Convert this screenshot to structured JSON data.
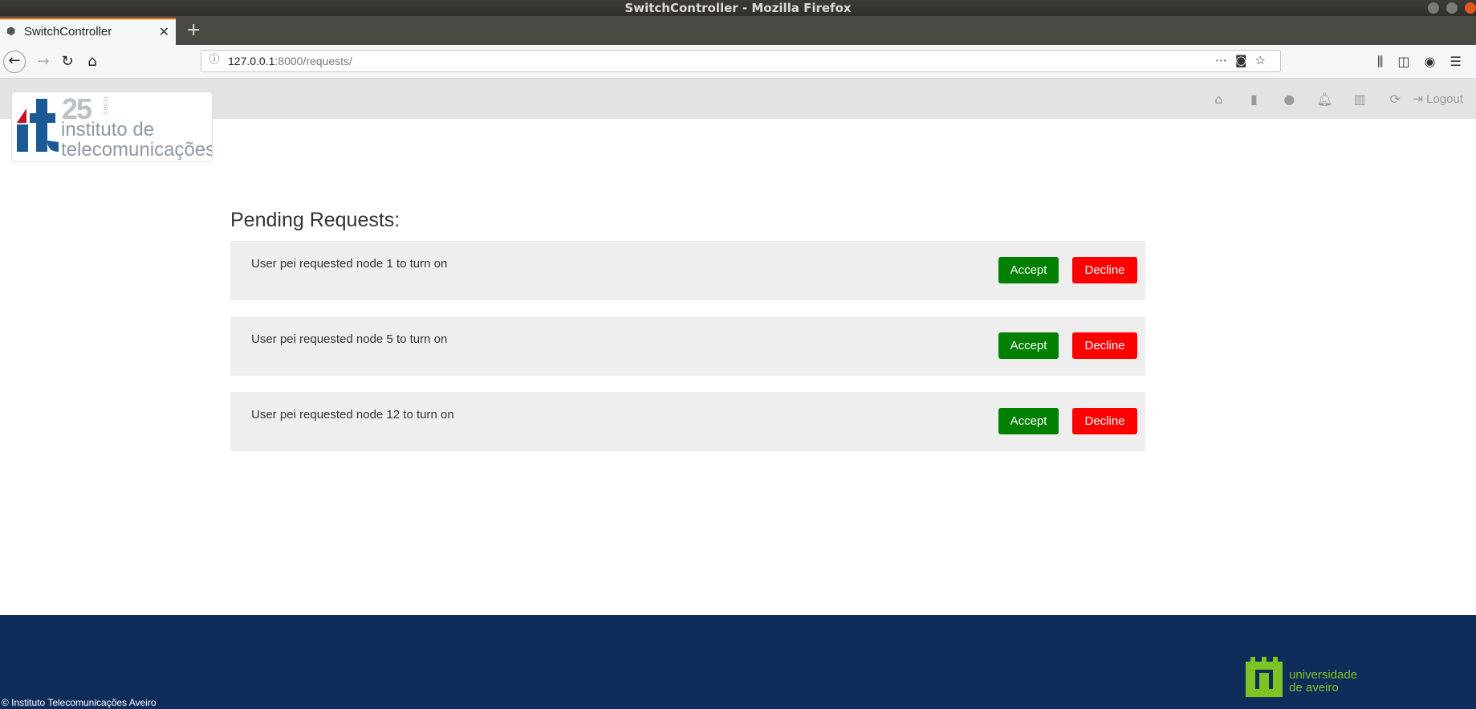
{
  "window": {
    "title": "SwitchController - Mozilla Firefox"
  },
  "browser": {
    "tab_title": "SwitchController",
    "url_host": "127.0.0.1",
    "url_rest": ":8000/requests/",
    "new_tab_symbol": "+"
  },
  "header": {
    "logo": {
      "years_number": "25",
      "years_label": "YEARS",
      "line1": "instituto de",
      "line2": "telecomunicações"
    },
    "nav_icons": [
      "home-icon",
      "book-icon",
      "alert-icon",
      "bell-icon",
      "bar-chart-icon",
      "refresh-icon"
    ],
    "logout_label": "Logout"
  },
  "main": {
    "title": "Pending Requests:",
    "requests": [
      {
        "text": "User pei requested node 1 to turn on",
        "accept_label": "Accept",
        "decline_label": "Decline"
      },
      {
        "text": "User pei requested node 5 to turn on",
        "accept_label": "Accept",
        "decline_label": "Decline"
      },
      {
        "text": "User pei requested node 12 to turn on",
        "accept_label": "Accept",
        "decline_label": "Decline"
      }
    ]
  },
  "footer": {
    "copyright": "© Instituto Telecomunicações Aveiro",
    "university_line1": "universidade",
    "university_line2": "de aveiro"
  },
  "colors": {
    "accept": "#008000",
    "decline": "#ff0000",
    "footer_bg": "#0f2d5a",
    "ua_green": "#7cc424"
  }
}
